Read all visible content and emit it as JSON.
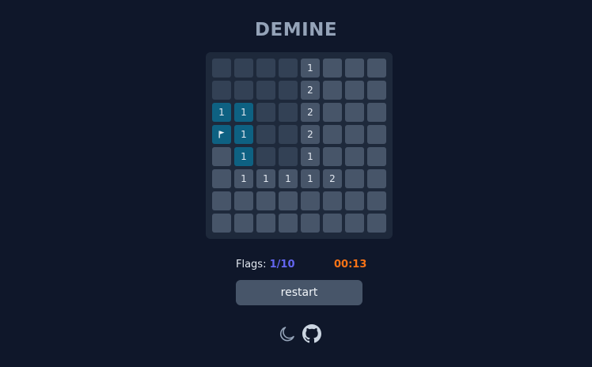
{
  "title": "DEMINE",
  "board": {
    "rows": 8,
    "cols": 8,
    "cells": [
      [
        "blank",
        "blank",
        "blank",
        "blank",
        "1",
        "hidden",
        "hidden",
        "hidden"
      ],
      [
        "blank",
        "blank",
        "blank",
        "blank",
        "2",
        "hidden",
        "hidden",
        "hidden"
      ],
      [
        "t1",
        "t1",
        "blank",
        "blank",
        "2",
        "hidden",
        "hidden",
        "hidden"
      ],
      [
        "flag",
        "t1",
        "blank",
        "blank",
        "2",
        "hidden",
        "hidden",
        "hidden"
      ],
      [
        "hidden",
        "t1",
        "blank",
        "blank",
        "1",
        "hidden",
        "hidden",
        "hidden"
      ],
      [
        "hidden",
        "1",
        "1",
        "1",
        "1",
        "2",
        "hidden",
        "hidden"
      ],
      [
        "hidden",
        "hidden",
        "hidden",
        "hidden",
        "hidden",
        "hidden",
        "hidden",
        "hidden"
      ],
      [
        "hidden",
        "hidden",
        "hidden",
        "hidden",
        "hidden",
        "hidden",
        "hidden",
        "hidden"
      ]
    ]
  },
  "stats": {
    "flags_label": "Flags:",
    "flags_value": "1/10",
    "timer": "00:13"
  },
  "controls": {
    "restart_label": "restart"
  },
  "footer": {
    "theme_icon": "moon-icon",
    "repo_icon": "github-icon"
  },
  "colors": {
    "background": "#0f172a",
    "board": "#1e293b",
    "cell_hidden": "#475569",
    "cell_revealed": "#334155",
    "cell_teal": "#0e6182",
    "flags_value": "#6366f1",
    "timer": "#f97316"
  }
}
